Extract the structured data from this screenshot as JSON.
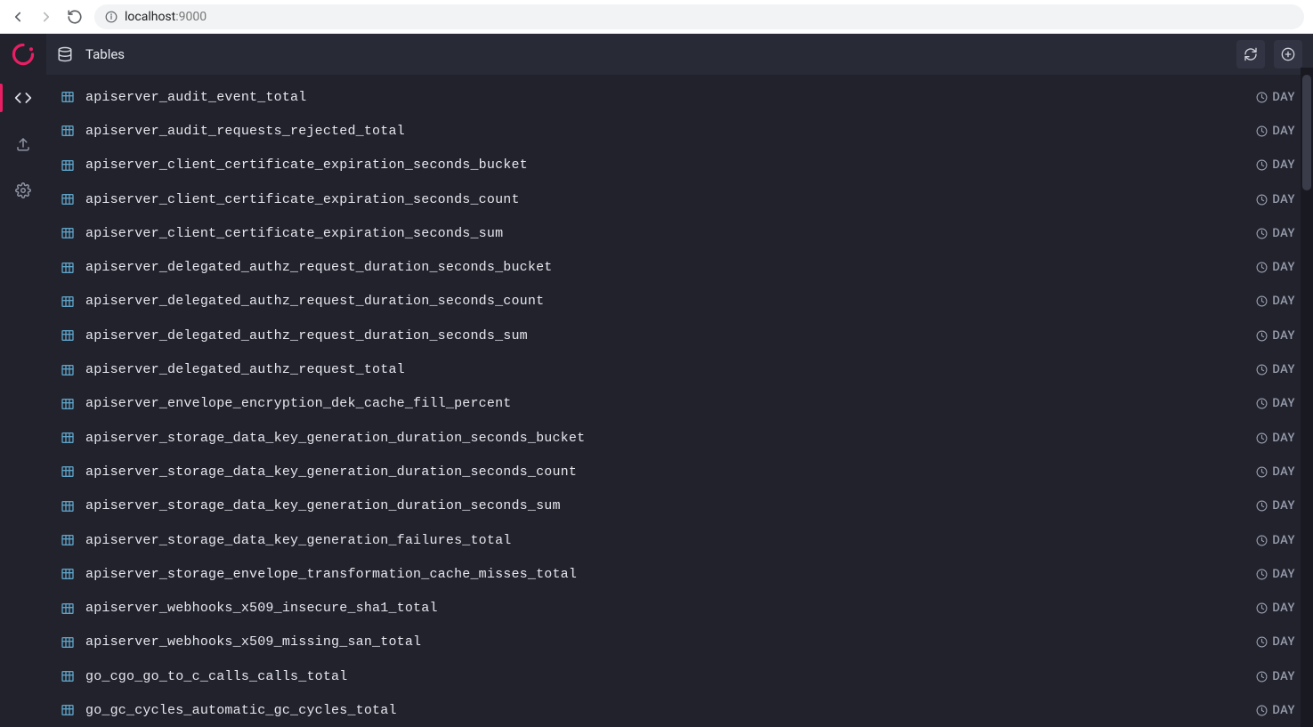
{
  "browser": {
    "host": "localhost",
    "port": ":9000"
  },
  "toolbar": {
    "title": "Tables"
  },
  "tables": [
    {
      "name": "apiserver_audit_event_total",
      "partition": "DAY"
    },
    {
      "name": "apiserver_audit_requests_rejected_total",
      "partition": "DAY"
    },
    {
      "name": "apiserver_client_certificate_expiration_seconds_bucket",
      "partition": "DAY"
    },
    {
      "name": "apiserver_client_certificate_expiration_seconds_count",
      "partition": "DAY"
    },
    {
      "name": "apiserver_client_certificate_expiration_seconds_sum",
      "partition": "DAY"
    },
    {
      "name": "apiserver_delegated_authz_request_duration_seconds_bucket",
      "partition": "DAY"
    },
    {
      "name": "apiserver_delegated_authz_request_duration_seconds_count",
      "partition": "DAY"
    },
    {
      "name": "apiserver_delegated_authz_request_duration_seconds_sum",
      "partition": "DAY"
    },
    {
      "name": "apiserver_delegated_authz_request_total",
      "partition": "DAY"
    },
    {
      "name": "apiserver_envelope_encryption_dek_cache_fill_percent",
      "partition": "DAY"
    },
    {
      "name": "apiserver_storage_data_key_generation_duration_seconds_bucket",
      "partition": "DAY"
    },
    {
      "name": "apiserver_storage_data_key_generation_duration_seconds_count",
      "partition": "DAY"
    },
    {
      "name": "apiserver_storage_data_key_generation_duration_seconds_sum",
      "partition": "DAY"
    },
    {
      "name": "apiserver_storage_data_key_generation_failures_total",
      "partition": "DAY"
    },
    {
      "name": "apiserver_storage_envelope_transformation_cache_misses_total",
      "partition": "DAY"
    },
    {
      "name": "apiserver_webhooks_x509_insecure_sha1_total",
      "partition": "DAY"
    },
    {
      "name": "apiserver_webhooks_x509_missing_san_total",
      "partition": "DAY"
    },
    {
      "name": "go_cgo_go_to_c_calls_calls_total",
      "partition": "DAY"
    },
    {
      "name": "go_gc_cycles_automatic_gc_cycles_total",
      "partition": "DAY"
    }
  ]
}
